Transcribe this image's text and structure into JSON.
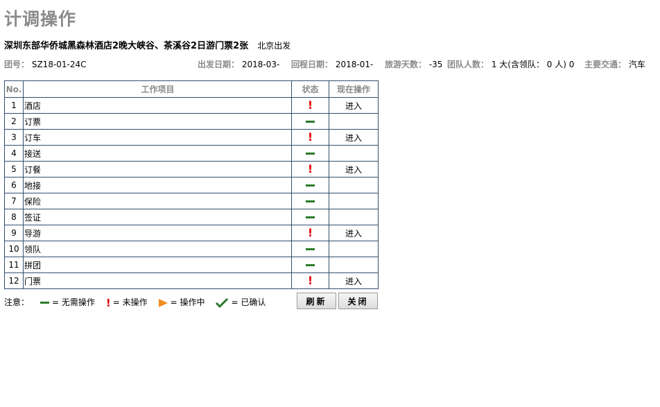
{
  "page": {
    "title": "计调操作"
  },
  "trip": {
    "name": "深圳东部华侨城黑森林酒店2晚大峡谷、茶溪谷2日游门票2张",
    "depart": "北京出发"
  },
  "info": {
    "group_label": "团号：",
    "group_value": "SZ18-01-24C",
    "start_label": "出发日期：",
    "start_value": "2018-03-",
    "return_label": "回程日期：",
    "return_value": "2018-01-",
    "days_label": "旅游天数：",
    "days_value": "-35",
    "people_label": "团队人数：",
    "people_value": "1 大(含领队： 0 人) 0",
    "transport_label": "主要交通：",
    "transport_value": "汽车"
  },
  "table": {
    "headers": {
      "no": "No.",
      "item": "工作项目",
      "status": "状态",
      "action": "现在操作"
    },
    "rows": [
      {
        "no": "1",
        "item": "酒店",
        "status": "pending",
        "action": "进入"
      },
      {
        "no": "2",
        "item": "订票",
        "status": "none",
        "action": ""
      },
      {
        "no": "3",
        "item": "订车",
        "status": "pending",
        "action": "进入"
      },
      {
        "no": "4",
        "item": "接送",
        "status": "none",
        "action": ""
      },
      {
        "no": "5",
        "item": "订餐",
        "status": "pending",
        "action": "进入"
      },
      {
        "no": "6",
        "item": "地接",
        "status": "none",
        "action": ""
      },
      {
        "no": "7",
        "item": "保险",
        "status": "none",
        "action": ""
      },
      {
        "no": "8",
        "item": "签证",
        "status": "none",
        "action": ""
      },
      {
        "no": "9",
        "item": "导游",
        "status": "pending",
        "action": "进入"
      },
      {
        "no": "10",
        "item": "领队",
        "status": "none",
        "action": ""
      },
      {
        "no": "11",
        "item": "拼团",
        "status": "none",
        "action": ""
      },
      {
        "no": "12",
        "item": "门票",
        "status": "pending",
        "action": "进入"
      }
    ]
  },
  "legend": {
    "prefix": "注意：",
    "none": "= 无需操作",
    "pending": "= 未操作",
    "in_progress": "= 操作中",
    "confirmed": "= 已确认"
  },
  "buttons": {
    "refresh": "刷新",
    "close": "关闭"
  },
  "colors": {
    "pending": "#e00000",
    "none": "#2b7a2b",
    "in_progress": "#f08c1e",
    "confirmed": "#2b7a2b",
    "border": "#2f4f6f"
  }
}
